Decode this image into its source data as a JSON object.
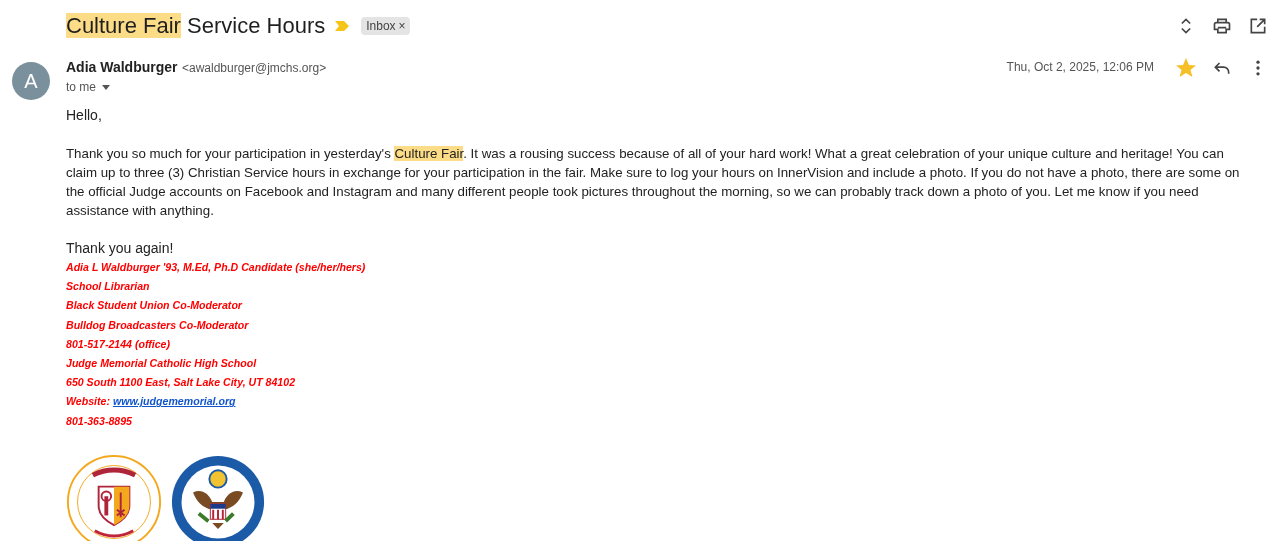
{
  "subject": {
    "parts": [
      {
        "text": "Culture Fair",
        "highlighted": true
      },
      {
        "text": "Service Hours",
        "highlighted": false
      }
    ],
    "label": "Inbox",
    "label_close": "×"
  },
  "sender": {
    "initial": "A",
    "name": "Adia Waldburger",
    "email": "<awaldburger@jmchs.org>",
    "recipient": "to me",
    "date": "Thu, Oct 2, 2025, 12:06 PM",
    "starred": true
  },
  "body": {
    "greeting": "Hello,",
    "paragraph": [
      {
        "text": "Thank you so much for your participation in yesterday's",
        "highlighted": false
      },
      {
        "text": "Culture Fair",
        "highlighted": true
      },
      {
        "text": ". It was a rousing success because of all of your hard work! What a great celebration of your unique culture and heritage! You can claim up to three (3) Christian Service hours in exchange for your participation in the fair. Make sure to log your hours on InnerVision and include a photo. If you do not have a photo, there are some on the official Judge accounts on Facebook and Instagram and many different people took pictures throughout the morning, so we can probably track down a photo of you. Let me know if you need assistance with anything.",
        "highlighted": false
      }
    ],
    "closing": "Thank you again!"
  },
  "signature": [
    {
      "text": "Adia L Waldburger '93, M.Ed, Ph.D Candidate (she/her/hers)"
    },
    {
      "text": "School Librarian"
    },
    {
      "text": "Black Student Union Co-Moderator"
    },
    {
      "text": "Bulldog Broadcasters Co-Moderator"
    },
    {
      "text": "801-517-2144 (office)"
    },
    {
      "text": "Judge Memorial Catholic High School"
    },
    {
      "text": "650 South 1100 East, Salt Lake City, UT 84102"
    },
    {
      "text": "Website:",
      "link": "www.judgememorial.org"
    },
    {
      "text": "801-363-8895"
    }
  ]
}
